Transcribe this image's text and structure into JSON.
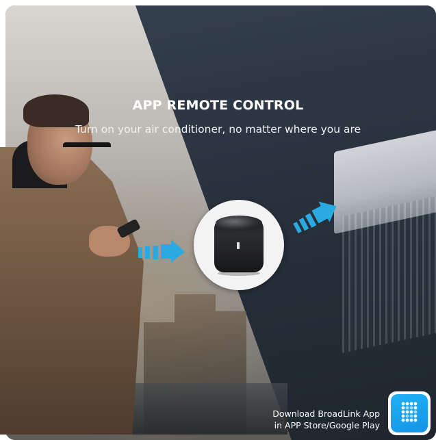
{
  "headline": {
    "title": "APP REMOTE CONTROL",
    "subtitle": "Turn on your air conditioner, no matter where you are"
  },
  "download": {
    "line1": "Download BroadLink App",
    "line2": "in APP Store/Google Play"
  },
  "app_icon": {
    "name": "broadlink-app-icon",
    "color": "#1a9cea"
  },
  "colors": {
    "arrow": "#29abe2",
    "card_dark": "#27303b",
    "device": "#1b1c1e"
  }
}
